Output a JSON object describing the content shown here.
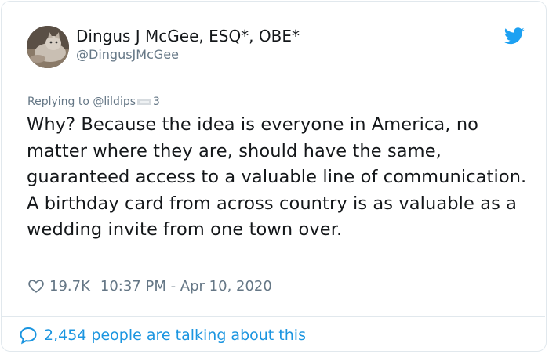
{
  "tweet": {
    "author": {
      "display_name": "Dingus J McGee, ESQ*, OBE*",
      "handle": "@DingusJMcGee",
      "avatar_icon": "cat-avatar-photo"
    },
    "platform_icon": "twitter-bird-icon",
    "replying_to_prefix": "Replying to ",
    "replying_to_handle": "@lildips",
    "replying_to_handle_suffix": "3",
    "text": "Why? Because the idea is everyone in America, no matter where they are, should have the same, guaranteed access to a valuable line of communication. A birthday card from across country is as valuable as a wedding invite from one town over.",
    "likes": "19.7K",
    "timestamp": "10:37 PM - Apr 10, 2020",
    "talking_text": "2,454 people are talking about this"
  },
  "colors": {
    "accent": "#1b95e0",
    "text": "#14171a",
    "secondary": "#657786",
    "border": "#e1e8ed"
  }
}
